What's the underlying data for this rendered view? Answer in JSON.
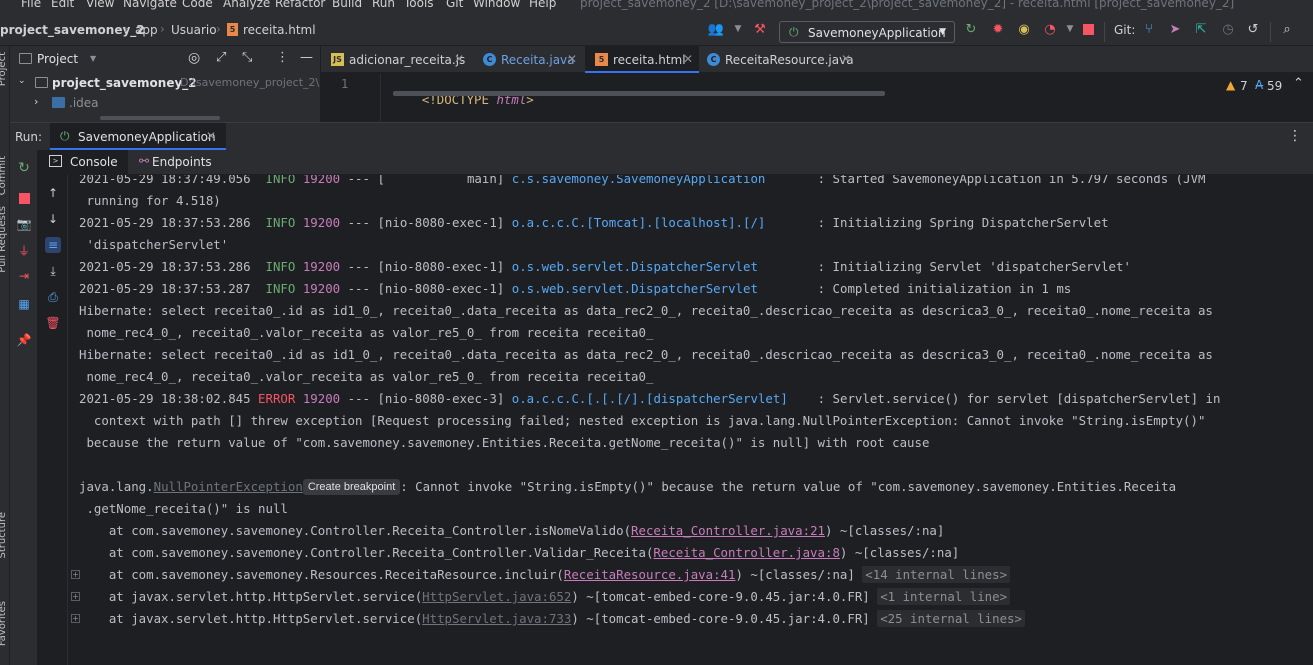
{
  "menu": [
    "File",
    "Edit",
    "View",
    "Navigate",
    "Code",
    "Analyze",
    "Refactor",
    "Build",
    "Run",
    "Tools",
    "Git",
    "Window",
    "Help"
  ],
  "window_title": "project_savemoney_2 [D:\\savemoney_project_2\\project_savemoney_2] - receita.html [project_savemoney_2]",
  "breadcrumb": [
    "project_savemoney_2",
    "app",
    "Usuario",
    "receita.html"
  ],
  "toolbar": {
    "run_config": "SavemoneyApplication",
    "git_label": "Git:"
  },
  "project_panel": {
    "title": "Project",
    "root_name": "project_savemoney_2",
    "root_path": "D:\\savemoney_project_2\\pr",
    "child": ".idea"
  },
  "editor": {
    "tabs": [
      {
        "label": "adicionar_receita.js",
        "icon": "JS"
      },
      {
        "label": "Receita.java",
        "icon": "C"
      },
      {
        "label": "receita.html",
        "icon": "5"
      },
      {
        "label": "ReceitaResource.java",
        "icon": "C"
      }
    ],
    "line_number": "1",
    "code_prefix": "<!DOCTYPE ",
    "code_keyword": "html",
    "code_suffix": ">",
    "warnings": "7",
    "typos": "59"
  },
  "run": {
    "label": "Run:",
    "tab": "SavemoneyApplication",
    "subtabs": [
      "Console",
      "Endpoints"
    ]
  },
  "left_stripe": [
    "Project",
    "Commit",
    "Pull Requests",
    "Structure",
    "Favorites"
  ],
  "console": {
    "l0": {
      "ts": "2021-05-29 18:37:49.056",
      "lvl": "INFO",
      "pid": "19200",
      "dash": "---",
      "thread": "[           main]",
      "logger": "c.s.savemoney.SavemoneyApplication",
      "msg": ": Started SavemoneyApplication in 5.797 seconds (JVM"
    },
    "l0b": " running for 4.518)",
    "l1": {
      "ts": "2021-05-29 18:37:53.286",
      "lvl": "INFO",
      "pid": "19200",
      "dash": "---",
      "thread": "[nio-8080-exec-1]",
      "logger": "o.a.c.c.C.[Tomcat].[localhost].[/]",
      "msg": ": Initializing Spring DispatcherServlet"
    },
    "l1b": " 'dispatcherServlet'",
    "l2": {
      "ts": "2021-05-29 18:37:53.286",
      "lvl": "INFO",
      "pid": "19200",
      "dash": "---",
      "thread": "[nio-8080-exec-1]",
      "logger": "o.s.web.servlet.DispatcherServlet",
      "msg": ": Initializing Servlet 'dispatcherServlet'"
    },
    "l3": {
      "ts": "2021-05-29 18:37:53.287",
      "lvl": "INFO",
      "pid": "19200",
      "dash": "---",
      "thread": "[nio-8080-exec-1]",
      "logger": "o.s.web.servlet.DispatcherServlet",
      "msg": ": Completed initialization in 1 ms"
    },
    "h1a": "Hibernate: select receita0_.id as id1_0_, receita0_.data_receita as data_rec2_0_, receita0_.descricao_receita as descrica3_0_, receita0_.nome_receita as",
    "h1b": " nome_rec4_0_, receita0_.valor_receita as valor_re5_0_ from receita receita0_",
    "h2a": "Hibernate: select receita0_.id as id1_0_, receita0_.data_receita as data_rec2_0_, receita0_.descricao_receita as descrica3_0_, receita0_.nome_receita as",
    "h2b": " nome_rec4_0_, receita0_.valor_receita as valor_re5_0_ from receita receita0_",
    "e1": {
      "ts": "2021-05-29 18:38:02.845",
      "lvl": "ERROR",
      "pid": "19200",
      "dash": "---",
      "thread": "[nio-8080-exec-3]",
      "logger": "o.a.c.c.C.[.[.[/].[dispatcherServlet]",
      "msg": ": Servlet.service() for servlet [dispatcherServlet] in"
    },
    "e1b": "  context with path [] threw exception [Request processing failed; nested exception is java.lang.NullPointerException: Cannot invoke \"String.isEmpty()\"",
    "e1c": " because the return value of \"com.savemoney.savemoney.Entities.Receita.getNome_receita()\" is null] with root cause",
    "ex_prefix": "java.lang.",
    "ex_name": "NullPointerException",
    "ex_bp": "Create breakpoint",
    "ex_msg": ": Cannot invoke \"String.isEmpty()\" because the return value of \"com.savemoney.savemoney.Entities.Receita",
    "ex_msg2": " .getNome_receita()\" is null",
    "st1": {
      "pre": "    at com.savemoney.savemoney.Controller.Receita_Controller.isNomeValido(",
      "link": "Receita_Controller.java:21",
      "post": ") ~[classes/:na]"
    },
    "st2": {
      "pre": "    at com.savemoney.savemoney.Controller.Receita_Controller.Validar_Receita(",
      "link": "Receita_Controller.java:8",
      "post": ") ~[classes/:na]"
    },
    "st3": {
      "pre": "    at com.savemoney.savemoney.Resources.ReceitaResource.incluir(",
      "link": "ReceitaResource.java:41",
      "post": ") ~[classes/:na] ",
      "internal": "<14 internal lines>"
    },
    "st4": {
      "pre": "    at javax.servlet.http.HttpServlet.service(",
      "link": "HttpServlet.java:652",
      "post": ") ~[tomcat-embed-core-9.0.45.jar:4.0.FR] ",
      "internal": "<1 internal line>"
    },
    "st5": {
      "pre": "    at javax.servlet.http.HttpServlet.service(",
      "link": "HttpServlet.java:733",
      "post": ") ~[tomcat-embed-core-9.0.45.jar:4.0.FR] ",
      "internal": "<25 internal lines>"
    }
  }
}
